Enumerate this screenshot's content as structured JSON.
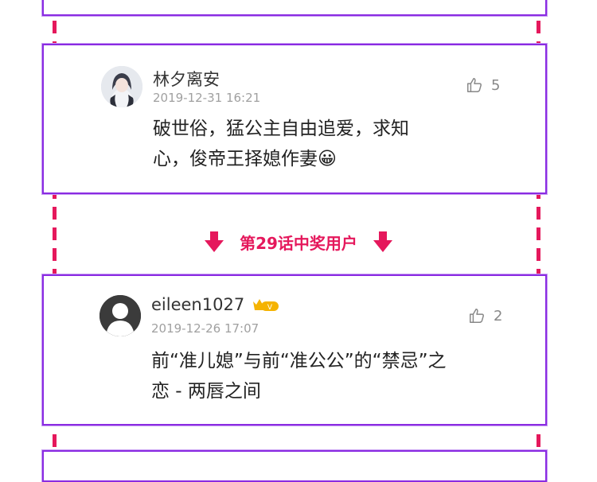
{
  "comments": [
    {
      "username": "林夕离安",
      "timestamp": "2019-12-31 16:21",
      "likes": "5",
      "content_line1": "破世俗，猛公主自由追爱，求知",
      "content_line2": "心，俊帝王择媳作妻",
      "emoji": "😀",
      "avatar": "user-avatar-illustration"
    },
    {
      "username": "eileen1027",
      "vip_badge": "V",
      "timestamp": "2019-12-26 17:07",
      "likes": "2",
      "content_line1": "前“准儿媳”与前“准公公”的“禁忌”之",
      "content_line2": "恋 - 两唇之间",
      "avatar": "default-avatar-icon"
    }
  ],
  "banner": {
    "text": "第29话中奖用户",
    "icon": "arrow-down-icon"
  },
  "colors": {
    "accent_pink": "#e5185c",
    "card_border": "#8a2be2",
    "vip_gold": "#f5b301"
  }
}
